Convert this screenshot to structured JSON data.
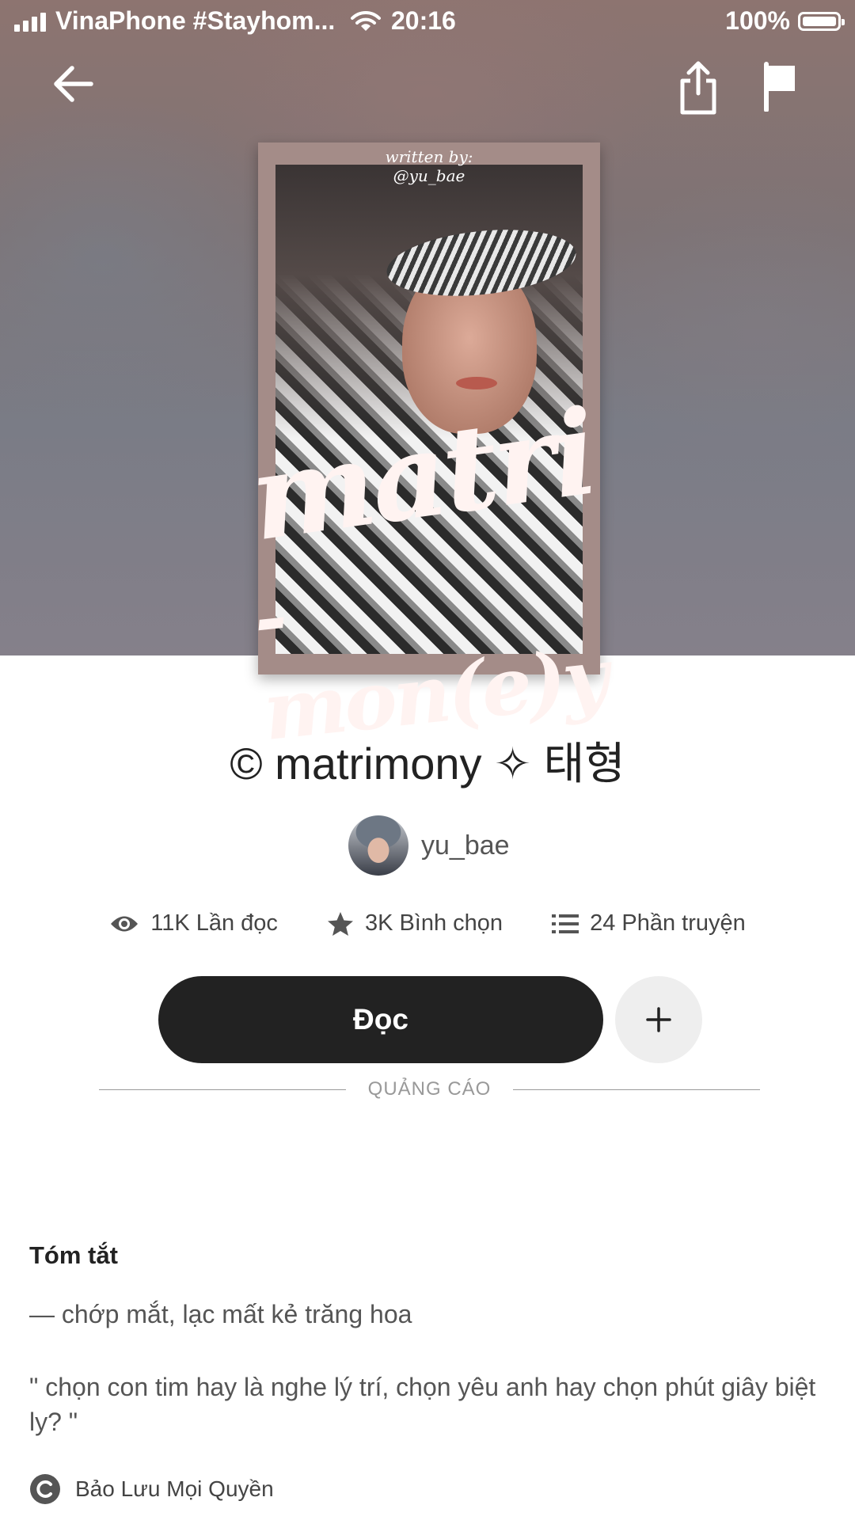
{
  "status_bar": {
    "carrier": "VinaPhone #Stayhom...",
    "time": "20:16",
    "battery": "100%"
  },
  "nav": {
    "back_icon": "arrow-left-icon",
    "share_icon": "share-icon",
    "report_icon": "flag-icon"
  },
  "cover": {
    "written_by_line1": "written by:",
    "written_by_line2": "@yu_bae",
    "title_art_line1": "matri",
    "title_art_line2": "-mon(e)y"
  },
  "story": {
    "title": "© matrimony ✧ 태형",
    "author": "yu_bae"
  },
  "stats": {
    "reads": "11K Lần đọc",
    "votes": "3K Bình chọn",
    "parts": "24 Phần truyện"
  },
  "actions": {
    "read_label": "Đọc",
    "add_label": "+"
  },
  "ad": {
    "label": "QUẢNG CÁO"
  },
  "summary": {
    "heading": "Tóm tắt",
    "line1": "— chớp mắt, lạc mất kẻ trăng hoa",
    "line2": "\" chọn con tim hay là nghe lý trí, chọn yêu anh hay chọn phút giây biệt ly? \"",
    "copyright": "Bảo Lưu Mọi Quyền"
  },
  "colors": {
    "primary_button": "#222222",
    "secondary_button": "#eeeeee",
    "text_muted": "#555555"
  }
}
